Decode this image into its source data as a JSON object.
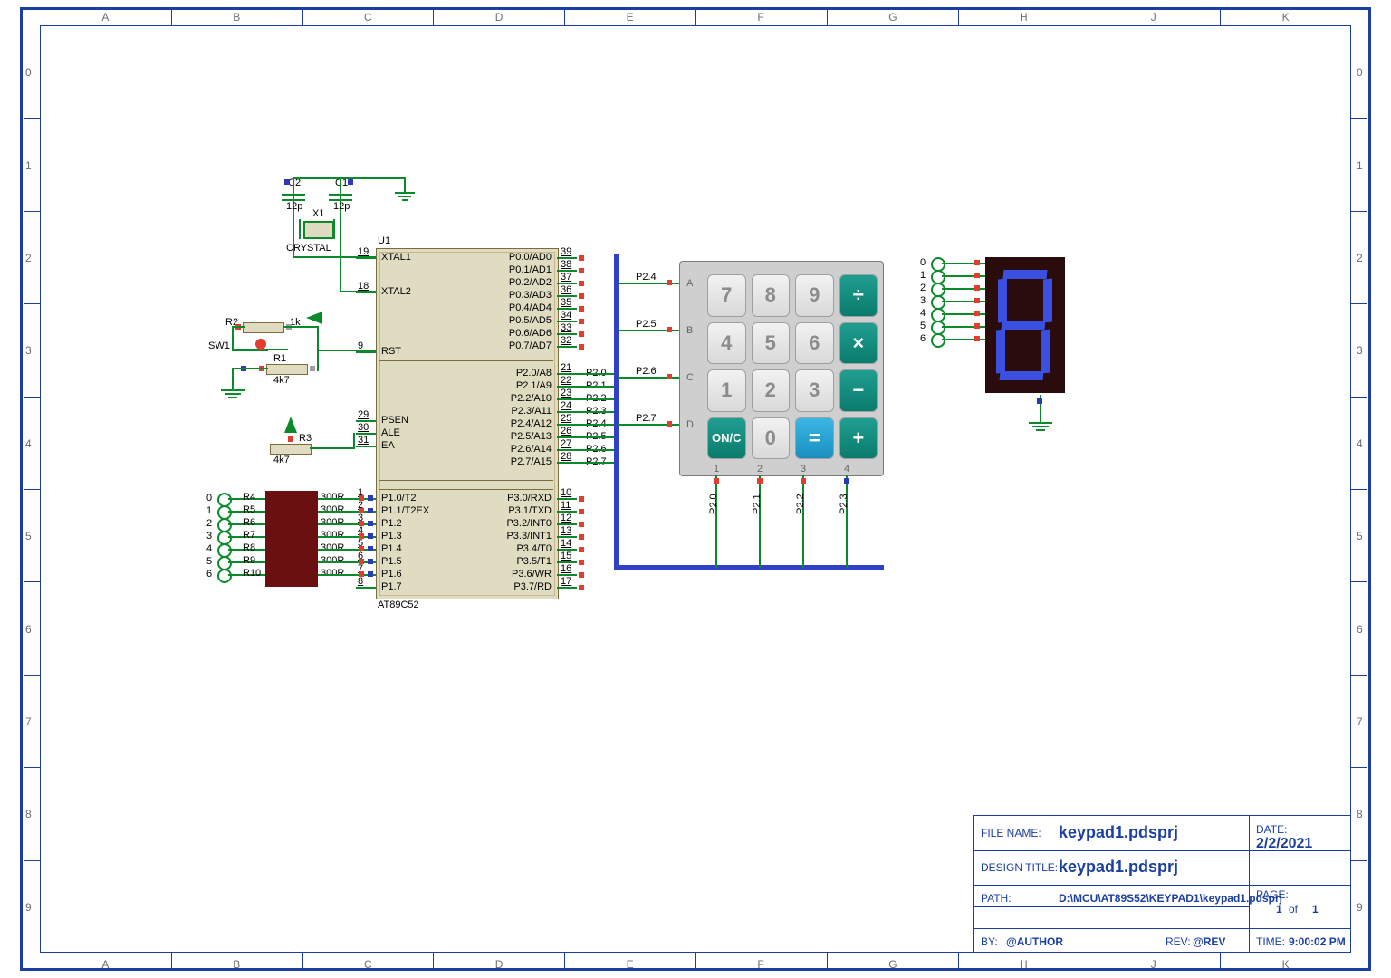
{
  "ruler": {
    "cols": [
      "A",
      "B",
      "C",
      "D",
      "E",
      "F",
      "G",
      "H",
      "J",
      "K"
    ],
    "rows": [
      "0",
      "1",
      "2",
      "3",
      "4",
      "5",
      "6",
      "7",
      "8",
      "9"
    ]
  },
  "mcu": {
    "ref": "U1",
    "part": "AT89C52",
    "left_pins": [
      {
        "num": "19",
        "name": "XTAL1"
      },
      {
        "num": "18",
        "name": "XTAL2"
      },
      {
        "num": "9",
        "name": "RST"
      },
      {
        "num": "29",
        "name": "PSEN"
      },
      {
        "num": "30",
        "name": "ALE"
      },
      {
        "num": "31",
        "name": "EA"
      },
      {
        "num": "1",
        "name": "P1.0/T2"
      },
      {
        "num": "2",
        "name": "P1.1/T2EX"
      },
      {
        "num": "3",
        "name": "P1.2"
      },
      {
        "num": "4",
        "name": "P1.3"
      },
      {
        "num": "5",
        "name": "P1.4"
      },
      {
        "num": "6",
        "name": "P1.5"
      },
      {
        "num": "7",
        "name": "P1.6"
      },
      {
        "num": "8",
        "name": "P1.7"
      }
    ],
    "right_top": [
      {
        "num": "39",
        "name": "P0.0/AD0"
      },
      {
        "num": "38",
        "name": "P0.1/AD1"
      },
      {
        "num": "37",
        "name": "P0.2/AD2"
      },
      {
        "num": "36",
        "name": "P0.3/AD3"
      },
      {
        "num": "35",
        "name": "P0.4/AD4"
      },
      {
        "num": "34",
        "name": "P0.5/AD5"
      },
      {
        "num": "33",
        "name": "P0.6/AD6"
      },
      {
        "num": "32",
        "name": "P0.7/AD7"
      }
    ],
    "right_p2": [
      {
        "num": "21",
        "name": "P2.0/A8",
        "net": "P2.0"
      },
      {
        "num": "22",
        "name": "P2.1/A9",
        "net": "P2.1"
      },
      {
        "num": "23",
        "name": "P2.2/A10",
        "net": "P2.2"
      },
      {
        "num": "24",
        "name": "P2.3/A11",
        "net": "P2.3"
      },
      {
        "num": "25",
        "name": "P2.4/A12",
        "net": "P2.4"
      },
      {
        "num": "26",
        "name": "P2.5/A13",
        "net": "P2.5"
      },
      {
        "num": "27",
        "name": "P2.6/A14",
        "net": "P2.6"
      },
      {
        "num": "28",
        "name": "P2.7/A15",
        "net": "P2.7"
      }
    ],
    "right_p3": [
      {
        "num": "10",
        "name": "P3.0/RXD"
      },
      {
        "num": "11",
        "name": "P3.1/TXD"
      },
      {
        "num": "12",
        "name": "P3.2/INT0"
      },
      {
        "num": "13",
        "name": "P3.3/INT1"
      },
      {
        "num": "14",
        "name": "P3.4/T0"
      },
      {
        "num": "15",
        "name": "P3.5/T1"
      },
      {
        "num": "16",
        "name": "P3.6/WR"
      },
      {
        "num": "17",
        "name": "P3.7/RD"
      }
    ]
  },
  "crystal": {
    "ref": "X1",
    "label": "CRYSTAL"
  },
  "caps": [
    {
      "ref": "C2",
      "value": "12p"
    },
    {
      "ref": "C1",
      "value": "12p"
    }
  ],
  "reset": {
    "sw": "SW1",
    "r1": {
      "ref": "R1",
      "value": "4k7"
    },
    "r2": {
      "ref": "R2",
      "value": "1k"
    }
  },
  "pullup": {
    "ref": "R3",
    "value": "4k7"
  },
  "resistors_series": {
    "value": "300R",
    "refs": [
      "R4",
      "R5",
      "R6",
      "R7",
      "R8",
      "R9",
      "R10"
    ]
  },
  "p1_terminals": [
    "0",
    "1",
    "2",
    "3",
    "4",
    "5",
    "6"
  ],
  "keypad": {
    "rows_label": [
      "A",
      "B",
      "C",
      "D"
    ],
    "cols_label": [
      "1",
      "2",
      "3",
      "4"
    ],
    "row_nets": [
      "P2.4",
      "P2.5",
      "P2.6",
      "P2.7"
    ],
    "col_nets": [
      "P2.0",
      "P2.1",
      "P2.2",
      "P2.3"
    ],
    "keys": [
      [
        "7",
        "8",
        "9",
        "÷"
      ],
      [
        "4",
        "5",
        "6",
        "×"
      ],
      [
        "1",
        "2",
        "3",
        "−"
      ],
      [
        "ON/C",
        "0",
        "=",
        "+"
      ]
    ]
  },
  "sevenseg": {
    "terminals": [
      "0",
      "1",
      "2",
      "3",
      "4",
      "5",
      "6"
    ]
  },
  "titleblock": {
    "filename_label": "FILE NAME:",
    "filename": "keypad1.pdsprj",
    "design_label": "DESIGN TITLE:",
    "design": "keypad1.pdsprj",
    "path_label": "PATH:",
    "path": "D:\\MCU\\AT89S52\\KEYPAD1\\keypad1.pdsprj",
    "by_label": "BY:",
    "by": "@AUTHOR",
    "rev_label": "REV:",
    "rev": "@REV",
    "date_label": "DATE:",
    "date": "2/2/2021",
    "page_label": "PAGE:",
    "page_of": "of",
    "page_cur": "1",
    "page_tot": "1",
    "time_label": "TIME:",
    "time": "9:00:02 PM"
  }
}
